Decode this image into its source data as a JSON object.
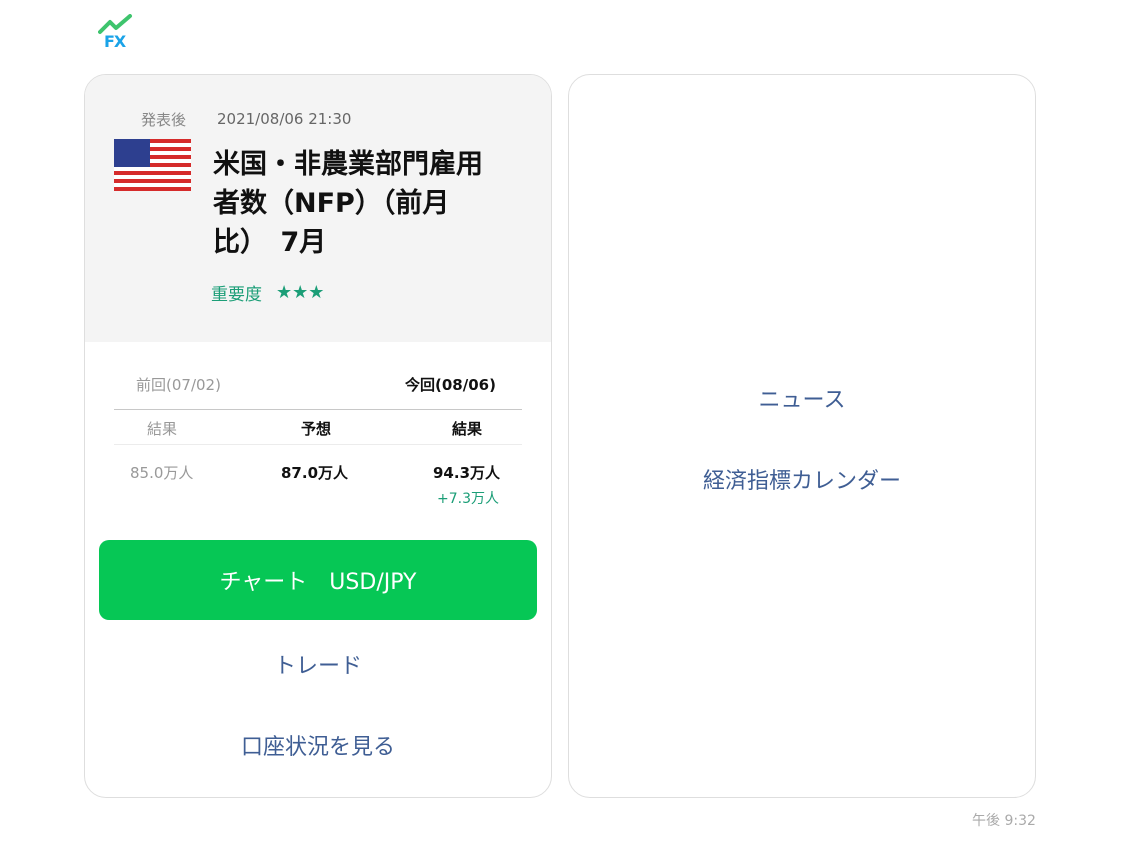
{
  "logo": {
    "text": "FX"
  },
  "card": {
    "status": "発表後",
    "datetime": "2021/08/06 21:30",
    "flag_icon": "us-flag-icon",
    "title": "米国・非農業部門雇用\n者数（NFP）（前月\n比）　7月",
    "importance_label": "重要度",
    "importance_stars": "★★★",
    "previous_label": "前回(07/02)",
    "current_label": "今回(08/06)",
    "columns": [
      "結果",
      "予想",
      "結果"
    ],
    "previous_result": "85.0万人",
    "forecast": "87.0万人",
    "current_result": "94.3万人",
    "difference": "+7.3万人",
    "chart_button": "チャート　USD/JPY",
    "trade_link": "トレード",
    "account_link": "口座状況を見る"
  },
  "right_card": {
    "news_link": "ニュース",
    "calendar_link": "経済指標カレンダー"
  },
  "timestamp": "午後 9:32",
  "colors": {
    "accent_green": "#06c755",
    "importance_green": "#1b9e77",
    "link_blue": "#3f5e94"
  }
}
